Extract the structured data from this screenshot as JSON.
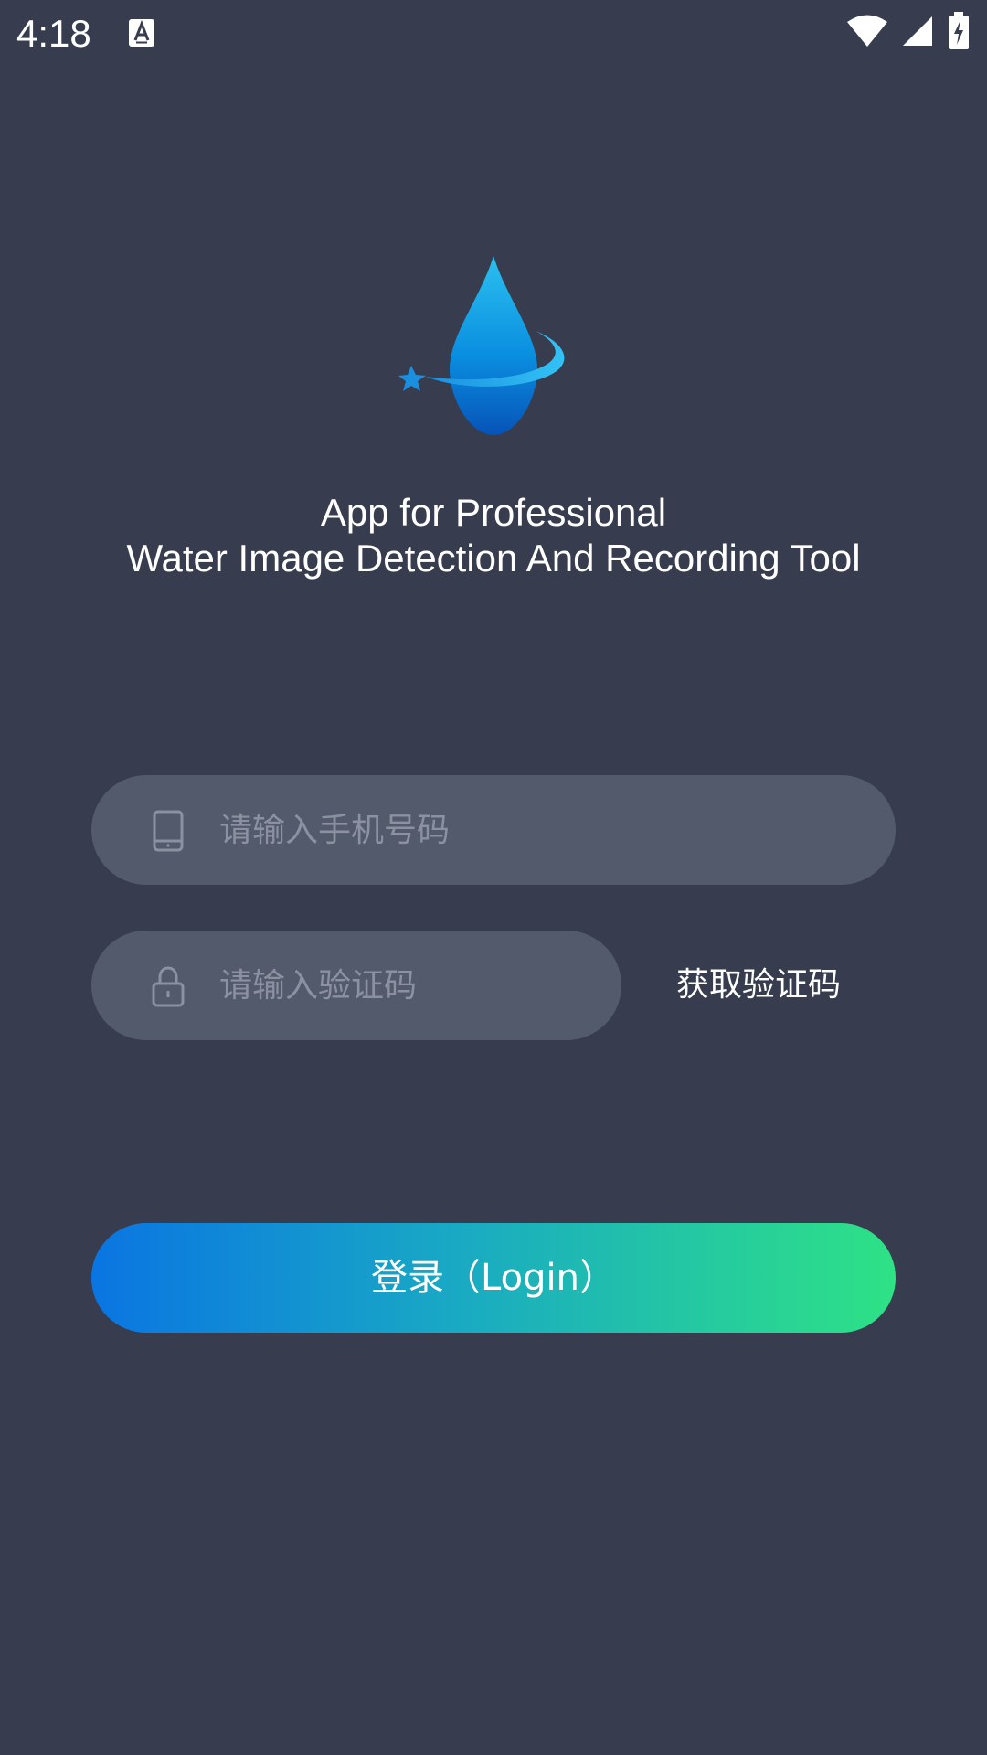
{
  "status_bar": {
    "time": "4:18",
    "notification_icon": "a-keyboard-icon",
    "wifi_icon": "wifi-icon",
    "signal_icon": "cell-signal-icon",
    "battery_icon": "battery-charging-icon"
  },
  "app": {
    "logo_icon": "water-drop-logo-icon",
    "title_line1": "App for Professional",
    "title_line2": "Water Image Detection And Recording Tool"
  },
  "form": {
    "phone": {
      "icon": "phone-icon",
      "placeholder": "请输入手机号码",
      "value": ""
    },
    "code": {
      "icon": "lock-icon",
      "placeholder": "请输入验证码",
      "value": ""
    },
    "get_code_label": "获取验证码",
    "login_label": "登录（Login）"
  },
  "colors": {
    "background": "#373d4f",
    "field": "#525a6b",
    "placeholder": "#8b91a0",
    "gradient_start": "#0a75e2",
    "gradient_end": "#2ee285"
  }
}
